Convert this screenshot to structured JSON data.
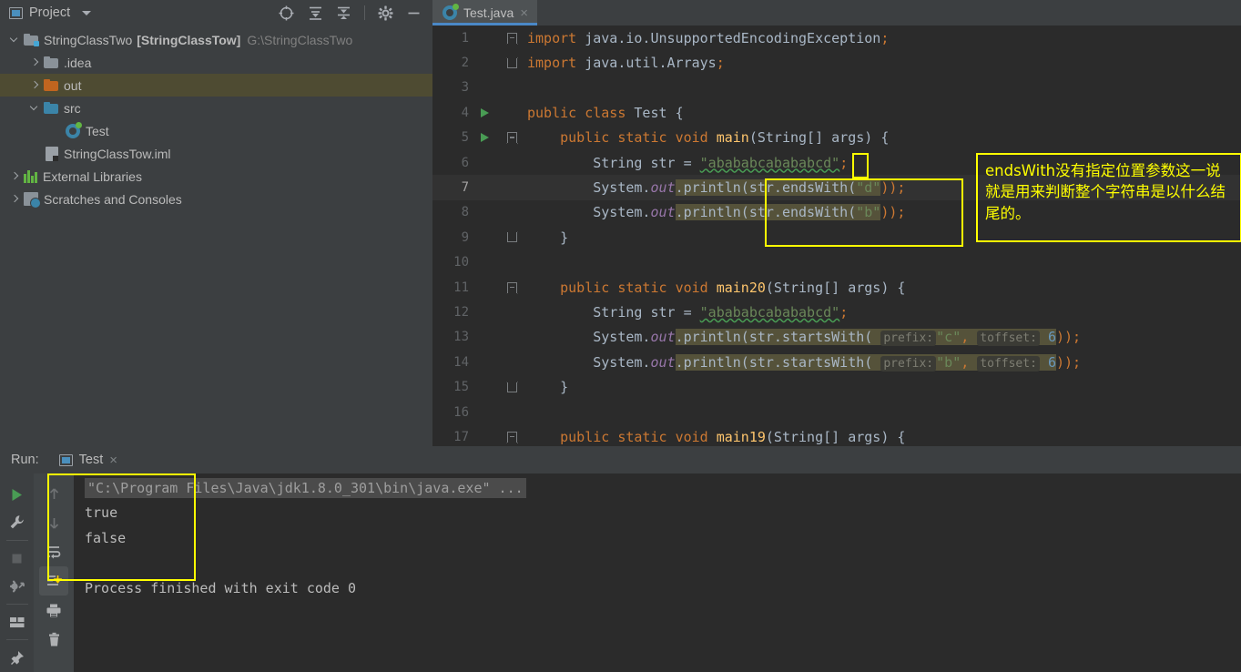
{
  "project_panel": {
    "title": "Project",
    "toolbar_icons": [
      "locate-icon",
      "expand-all-icon",
      "collapse-all-icon",
      "settings-gear-icon",
      "hide-icon"
    ],
    "tree": [
      {
        "label": "StringClassTwo",
        "bold": "[StringClassTow]",
        "path": "G:\\StringClassTwo",
        "icon": "module-folder-icon",
        "indent": 0,
        "arrow": "open",
        "selected": false
      },
      {
        "label": ".idea",
        "icon": "folder-gray-icon",
        "indent": 1,
        "arrow": "closed",
        "selected": false
      },
      {
        "label": "out",
        "icon": "folder-orange-icon",
        "indent": 1,
        "arrow": "closed",
        "selected": true
      },
      {
        "label": "src",
        "icon": "folder-blue-icon",
        "indent": 1,
        "arrow": "open",
        "selected": false
      },
      {
        "label": "Test",
        "icon": "java-class-icon",
        "indent": 2,
        "arrow": "none",
        "selected": false
      },
      {
        "label": "StringClassTow.iml",
        "icon": "iml-file-icon",
        "indent": 1,
        "arrow": "none",
        "selected": false
      },
      {
        "label": "External Libraries",
        "icon": "libraries-icon",
        "indent": 0,
        "arrow": "closed",
        "selected": false
      },
      {
        "label": "Scratches and Consoles",
        "icon": "scratches-icon",
        "indent": 0,
        "arrow": "closed",
        "selected": false
      }
    ]
  },
  "editor": {
    "tab": {
      "label": "Test.java",
      "icon": "java-class-icon",
      "close": "×"
    },
    "lines": [
      {
        "n": "1",
        "fold": "top",
        "run": false,
        "current": false
      },
      {
        "n": "2",
        "fold": "mid",
        "run": false,
        "current": false
      },
      {
        "n": "3",
        "fold": "none",
        "run": false,
        "current": false
      },
      {
        "n": "4",
        "fold": "none",
        "run": true,
        "current": false
      },
      {
        "n": "5",
        "fold": "top",
        "run": true,
        "current": false
      },
      {
        "n": "6",
        "fold": "line",
        "run": false,
        "current": false
      },
      {
        "n": "7",
        "fold": "line",
        "run": false,
        "current": true
      },
      {
        "n": "8",
        "fold": "line",
        "run": false,
        "current": false
      },
      {
        "n": "9",
        "fold": "end",
        "run": false,
        "current": false
      },
      {
        "n": "10",
        "fold": "none",
        "run": false,
        "current": false
      },
      {
        "n": "11",
        "fold": "top",
        "run": false,
        "current": false
      },
      {
        "n": "12",
        "fold": "line",
        "run": false,
        "current": false
      },
      {
        "n": "13",
        "fold": "line",
        "run": false,
        "current": false
      },
      {
        "n": "14",
        "fold": "line",
        "run": false,
        "current": false
      },
      {
        "n": "15",
        "fold": "end",
        "run": false,
        "current": false
      },
      {
        "n": "16",
        "fold": "none",
        "run": false,
        "current": false
      },
      {
        "n": "17",
        "fold": "top",
        "run": false,
        "current": false
      }
    ],
    "code": {
      "l1_kw": "import",
      "l1_rest": " java.io.UnsupportedEncodingException",
      "l1_semi": ";",
      "l2_kw": "import",
      "l2_rest": " java.util.Arrays",
      "l2_semi": ";",
      "l4_kw1": "public",
      "l4_kw2": "class",
      "l4_name": "Test",
      "l4_brace": "{",
      "l5_kw1": "public",
      "l5_kw2": "static",
      "l5_kw3": "void",
      "l5_name": "main",
      "l5_args": "(String[] args) {",
      "l6_type": "String",
      "l6_var": " str = ",
      "l6_str": "\"ababab cabababcd\"",
      "l6_semi": ";",
      "l6_strtext": "\"ababab­cabababcd\"",
      "l7_sys": "System.",
      "l7_out": "out",
      "l7_pr": ".println(str.endsWith(",
      "l7_arg": "\"d\"",
      "l7_tail": "));",
      "l8_sys": "System.",
      "l8_out": "out",
      "l8_pr": ".println(str.endsWith(",
      "l8_arg": "\"b\"",
      "l8_tail": "));",
      "l9_brace": "}",
      "l11_kw1": "public",
      "l11_kw2": "static",
      "l11_kw3": "void",
      "l11_name": "main20",
      "l11_args": "(String[] args) {",
      "l12_type": "String",
      "l12_var": " str = ",
      "l12_str": "\"ababab­cabababcd\"",
      "l12_semi": ";",
      "l13_sys": "System.",
      "l13_out": "out",
      "l13_pr": ".println(str.startsWith(",
      "l13_h1": "prefix:",
      "l13_arg1": "\"c\"",
      "l13_comma": ", ",
      "l13_h2": "toffset:",
      "l13_arg2": "6",
      "l13_tail": "));",
      "l14_sys": "System.",
      "l14_out": "out",
      "l14_pr": ".println(str.startsWith(",
      "l14_h1": "prefix:",
      "l14_arg1": "\"b\"",
      "l14_comma": ", ",
      "l14_h2": "toffset:",
      "l14_arg2": "6",
      "l14_tail": "));",
      "l15_brace": "}",
      "l17_kw1": "public",
      "l17_kw2": "static",
      "l17_kw3": "void",
      "l17_name": "main19",
      "l17_args": "(String[] args) {"
    }
  },
  "annotation": {
    "note_text": "endsWith没有指定位置参数这一说就是用来判断整个字符串是以什么结尾的。",
    "color": "#ffff00"
  },
  "run_panel": {
    "label": "Run:",
    "tab_label": "Test",
    "tab_close": "×",
    "tools_left": [
      "run-icon",
      "wrench-icon",
      "stop-icon",
      "rerun-failed-icon",
      "layout-icon",
      "pin-icon"
    ],
    "tools_right": [
      "scroll-up-icon",
      "scroll-down-icon",
      "soft-wrap-icon",
      "scroll-to-end-icon",
      "print-icon",
      "clear-all-icon"
    ],
    "console": {
      "command": "\"C:\\Program Files\\Java\\jdk1.8.0_301\\bin\\java.exe\" ...",
      "output": [
        "true",
        "false"
      ],
      "finished": "Process finished with exit code 0"
    }
  },
  "colors": {
    "accent": "#4a88c7",
    "annotation": "#ffff00",
    "selection": "#55523a",
    "tree_selected": "#4e4b32",
    "editor_bg": "#2b2b2b",
    "panel_bg": "#3c3f41"
  }
}
